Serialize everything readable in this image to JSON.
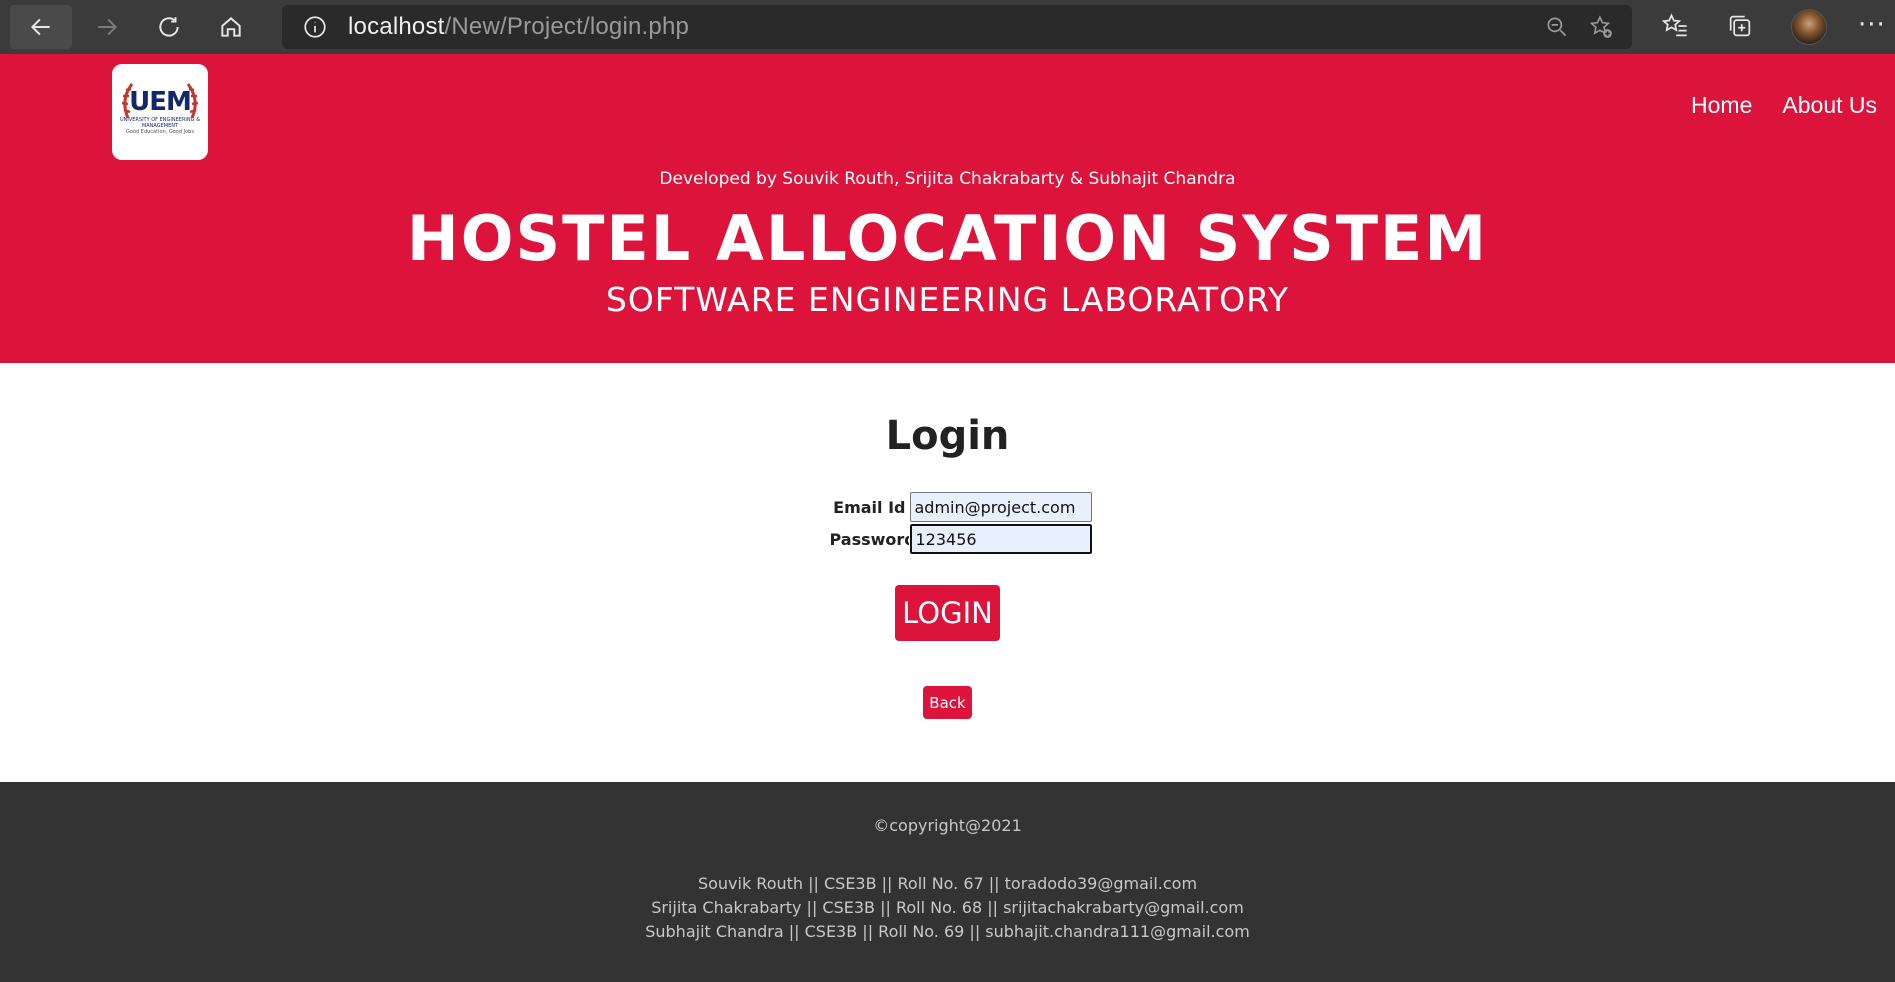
{
  "browser": {
    "url_host": "localhost",
    "url_path": "/New/Project/login.php"
  },
  "header": {
    "logo_text": "UEM",
    "logo_subtitle": "UNIVERSITY OF ENGINEERING & MANAGEMENT",
    "logo_tagline": "Good Education, Good Jobs",
    "nav": [
      {
        "label": "Home"
      },
      {
        "label": "About Us"
      }
    ],
    "developers": "Developed by Souvik Routh, Srijita Chakrabarty & Subhajit Chandra",
    "title": "HOSTEL ALLOCATION SYSTEM",
    "subtitle": "SOFTWARE ENGINEERING LABORATORY"
  },
  "login": {
    "title": "Login",
    "email_label": "Email Id",
    "email_value": "admin@project.com",
    "password_label": "Password",
    "password_value": "123456",
    "login_button": "LOGIN",
    "back_button": "Back"
  },
  "footer": {
    "copyright": "©copyright@2021",
    "credits": [
      "Souvik Routh || CSE3B || Roll No. 67 || toradodo39@gmail.com",
      "Srijita Chakrabarty || CSE3B || Roll No. 68 || srijitachakrabarty@gmail.com",
      "Subhajit Chandra || CSE3B || Roll No. 69 || subhajit.chandra111@gmail.com"
    ]
  },
  "colors": {
    "brand_red": "#dc143c",
    "footer_bg": "#333333",
    "chrome_bg": "#3b3b3b"
  }
}
